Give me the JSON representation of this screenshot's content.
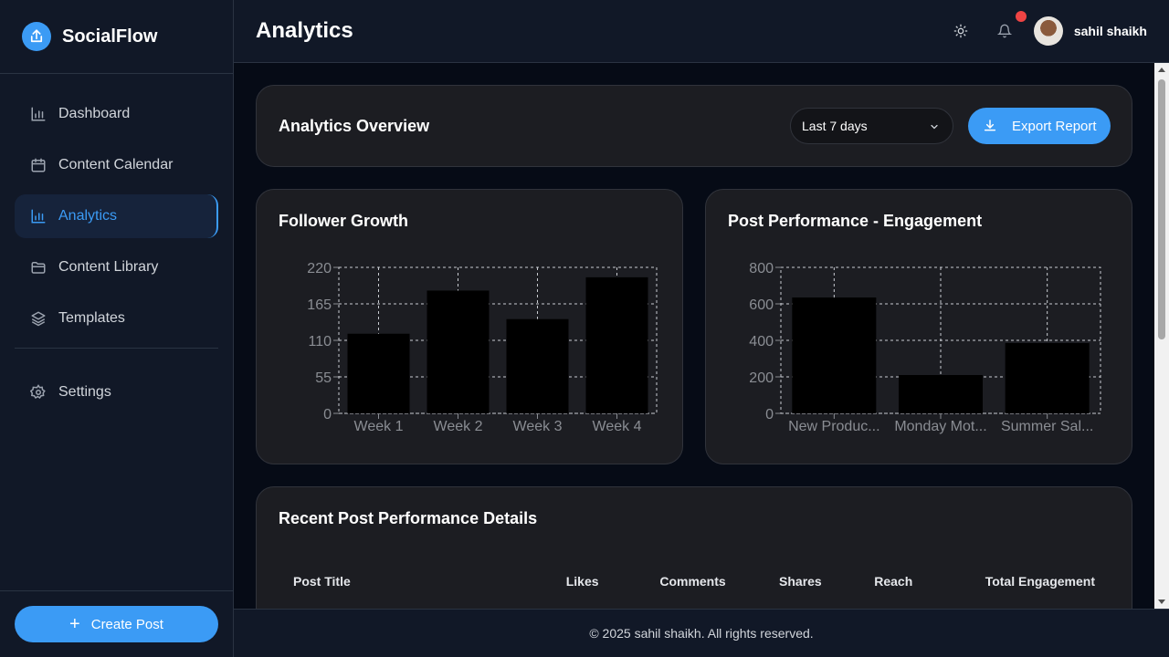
{
  "app": {
    "name": "SocialFlow",
    "logo_icon": "upload-icon"
  },
  "sidebar": {
    "items": [
      {
        "label": "Dashboard",
        "icon": "bar-chart-icon"
      },
      {
        "label": "Content Calendar",
        "icon": "calendar-icon"
      },
      {
        "label": "Analytics",
        "icon": "bar-chart-icon",
        "active": true
      },
      {
        "label": "Content Library",
        "icon": "folder-icon"
      },
      {
        "label": "Templates",
        "icon": "layers-icon"
      }
    ],
    "secondary_items": [
      {
        "label": "Settings",
        "icon": "gear-icon"
      }
    ],
    "create_button": "Create Post"
  },
  "header": {
    "title": "Analytics",
    "user_name": "sahil shaikh",
    "icons": [
      "sun-icon",
      "bell-icon"
    ]
  },
  "overview": {
    "title": "Analytics Overview",
    "range_value": "Last 7 days",
    "export_label": "Export Report"
  },
  "follower_chart": {
    "title": "Follower Growth"
  },
  "engagement_chart": {
    "title": "Post Performance - Engagement"
  },
  "chart_data": [
    {
      "type": "bar",
      "title": "Follower Growth",
      "categories": [
        "Week 1",
        "Week 2",
        "Week 3",
        "Week 4"
      ],
      "values": [
        120,
        185,
        142,
        205
      ],
      "yticks": [
        "0",
        "55",
        "110",
        "165",
        "220"
      ],
      "ylim": [
        0,
        220
      ],
      "grid": true,
      "bar_color": "#000000"
    },
    {
      "type": "bar",
      "title": "Post Performance - Engagement",
      "categories": [
        "New Produc...",
        "Monday Mot...",
        "Summer Sal..."
      ],
      "values": [
        635,
        210,
        385
      ],
      "yticks": [
        "0",
        "200",
        "400",
        "600",
        "800"
      ],
      "ylim": [
        0,
        800
      ],
      "grid": true,
      "bar_color": "#000000"
    }
  ],
  "recent": {
    "title": "Recent Post Performance Details",
    "columns": [
      "Post Title",
      "Likes",
      "Comments",
      "Shares",
      "Reach",
      "Total Engagement"
    ]
  },
  "footer": {
    "text": "© 2025 sahil shaikh. All rights reserved."
  },
  "colors": {
    "accent": "#3b9bf5",
    "sidebar_bg": "#111827",
    "card_bg": "#1c1d22",
    "notification": "#ef4444"
  }
}
